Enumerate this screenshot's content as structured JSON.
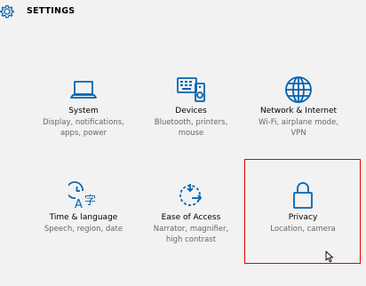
{
  "header": {
    "title": "SETTINGS",
    "icon": "gear-icon"
  },
  "accent_color": "#0063b1",
  "highlight_color": "#e60000",
  "tiles": [
    {
      "title": "System",
      "desc": "Display, notifications,\napps, power",
      "icon": "laptop-icon"
    },
    {
      "title": "Devices",
      "desc": "Bluetooth, printers,\nmouse",
      "icon": "keyboard-speaker-icon"
    },
    {
      "title": "Network & Internet",
      "desc": "Wi-Fi, airplane mode,\nVPN",
      "icon": "globe-icon"
    },
    {
      "title": "Time & language",
      "desc": "Speech, region, date",
      "icon": "clock-language-icon"
    },
    {
      "title": "Ease of Access",
      "desc": "Narrator, magnifier,\nhigh contrast",
      "icon": "ease-of-access-icon"
    },
    {
      "title": "Privacy",
      "desc": "Location, camera",
      "icon": "lock-icon"
    }
  ]
}
